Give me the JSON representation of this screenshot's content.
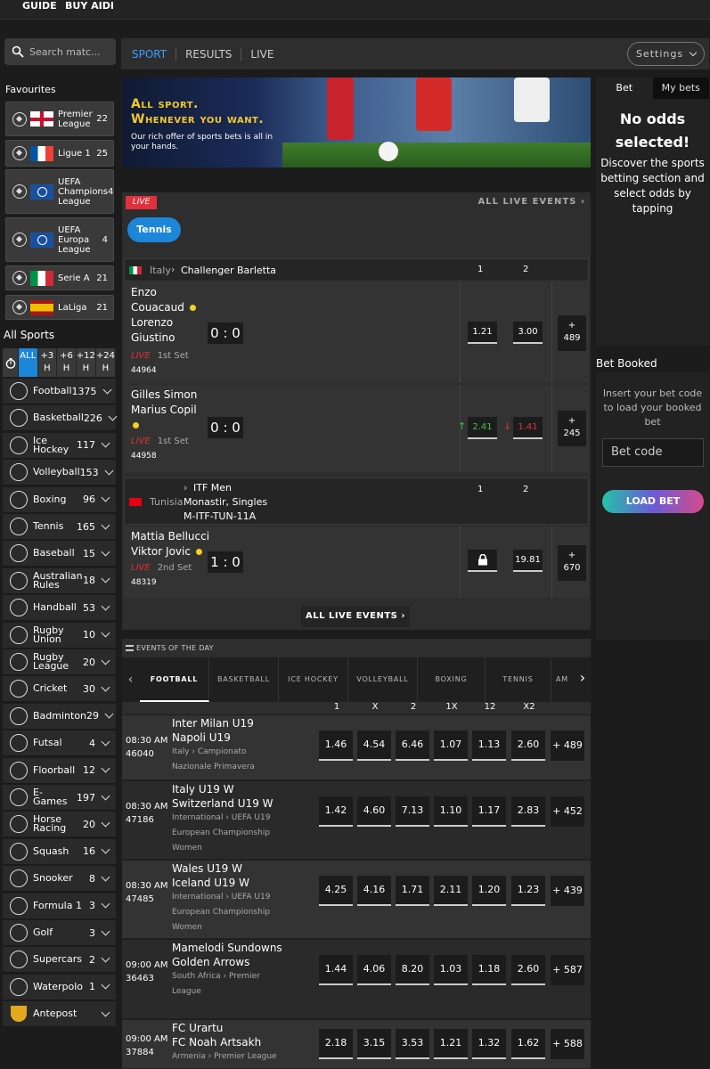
{
  "top_nav": {
    "guide": "GUIDE",
    "buy": "BUY AIDI"
  },
  "search": {
    "placeholder": "Search matc..."
  },
  "favourites": {
    "title": "Favourites",
    "items": [
      {
        "name": "Premier League",
        "count": "22",
        "flag": "england"
      },
      {
        "name": "Ligue 1",
        "count": "25",
        "flag": "france"
      },
      {
        "name": "UEFA Champions League",
        "count": "4",
        "flag": "europe"
      },
      {
        "name": "UEFA Europa League",
        "count": "4",
        "flag": "europe"
      },
      {
        "name": "Serie A",
        "count": "21",
        "flag": "italy"
      },
      {
        "name": "LaLiga",
        "count": "21",
        "flag": "spain"
      }
    ]
  },
  "all_sports": {
    "title": "All Sports",
    "time_filters": [
      "ALL",
      "+3 H",
      "+6 H",
      "+12 H",
      "+24 H"
    ],
    "items": [
      {
        "name": "Football",
        "count": "1375",
        "icon": "football-icon"
      },
      {
        "name": "Basketball",
        "count": "226",
        "icon": "basketball-icon"
      },
      {
        "name": "Ice Hockey",
        "count": "117",
        "icon": "ice-hockey-icon"
      },
      {
        "name": "Volleyball",
        "count": "153",
        "icon": "volleyball-icon"
      },
      {
        "name": "Boxing",
        "count": "96",
        "icon": "boxing-icon"
      },
      {
        "name": "Tennis",
        "count": "165",
        "icon": "tennis-icon"
      },
      {
        "name": "Baseball",
        "count": "15",
        "icon": "baseball-icon"
      },
      {
        "name": "Australian Rules",
        "count": "18",
        "icon": "australian-rules-icon"
      },
      {
        "name": "Handball",
        "count": "53",
        "icon": "handball-icon"
      },
      {
        "name": "Rugby Union",
        "count": "10",
        "icon": "rugby-union-icon"
      },
      {
        "name": "Rugby League",
        "count": "20",
        "icon": "rugby-league-icon"
      },
      {
        "name": "Cricket",
        "count": "30",
        "icon": "cricket-icon"
      },
      {
        "name": "Badminton",
        "count": "29",
        "icon": "badminton-icon"
      },
      {
        "name": "Futsal",
        "count": "4",
        "icon": "futsal-icon"
      },
      {
        "name": "Floorball",
        "count": "12",
        "icon": "floorball-icon"
      },
      {
        "name": "E-Games",
        "count": "197",
        "icon": "e-games-icon"
      },
      {
        "name": "Horse Racing",
        "count": "20",
        "icon": "horse-racing-icon"
      },
      {
        "name": "Squash",
        "count": "16",
        "icon": "squash-icon"
      },
      {
        "name": "Snooker",
        "count": "8",
        "icon": "snooker-icon"
      },
      {
        "name": "Formula 1",
        "count": "3",
        "icon": "formula1-icon"
      },
      {
        "name": "Golf",
        "count": "3",
        "icon": "golf-icon"
      },
      {
        "name": "Supercars",
        "count": "2",
        "icon": "supercars-icon"
      },
      {
        "name": "Waterpolo",
        "count": "1",
        "icon": "waterpolo-icon"
      },
      {
        "name": "Antepost",
        "count": "",
        "icon": "trophy-icon"
      }
    ]
  },
  "nav": {
    "sport": "SPORT",
    "results": "RESULTS",
    "live": "LIVE",
    "settings": "Settings"
  },
  "banner": {
    "headline_1": "All sport.",
    "headline_2": "Whenever you want.",
    "sub": "Our rich offer of sports bets is all in your hands."
  },
  "live": {
    "badge": "LIVE",
    "all_events": "ALL LIVE EVENTS",
    "sport_pill": "Tennis",
    "bottom_button": "ALL LIVE EVENTS",
    "leagues": [
      {
        "country": "Italy",
        "name": "Challenger Barletta",
        "col1": "1",
        "col2": "2",
        "events": [
          {
            "p1": "Enzo Couacaud",
            "p2": "Lorenzo Giustino",
            "score": "0 : 0",
            "live": "LIVE",
            "set": "1st Set",
            "id": "44964",
            "odd1": "1.21",
            "odd2": "3.00",
            "more_plus": "+",
            "more": "489"
          },
          {
            "p1": "Gilles Simon",
            "p2": "Marius Copil",
            "score": "0 : 0",
            "live": "LIVE",
            "set": "1st Set",
            "id": "44958",
            "odd1": "2.41",
            "odd2": "1.41",
            "more_plus": "+",
            "more": "245"
          }
        ]
      },
      {
        "country": "Tunisia",
        "name_1": "ITF Men",
        "name_2": "Monastir, Singles",
        "name_3": "M-ITF-TUN-11A",
        "col1": "1",
        "col2": "2",
        "events": [
          {
            "p1": "Mattia Bellucci",
            "p2": "Viktor Jovic",
            "score": "1 : 0",
            "live": "LIVE",
            "set": "2nd Set",
            "id": "48319",
            "odd1": "",
            "odd2": "19.81",
            "more_plus": "+",
            "more": "670"
          }
        ]
      }
    ]
  },
  "events_of_day": {
    "title": "EVENTS OF THE DAY",
    "tabs": [
      "FOOTBALL",
      "BASKETBALL",
      "ICE HOCKEY",
      "VOLLEYBALL",
      "BOXING",
      "TENNIS",
      "AM"
    ],
    "columns": [
      "1",
      "X",
      "2",
      "1X",
      "12",
      "X2"
    ],
    "rows": [
      {
        "time": "08:30 AM",
        "id": "46040",
        "team1": "Inter Milan U19",
        "team2": "Napoli U19",
        "country": "Italy",
        "league": "Campionato Nazionale Primavera",
        "odds": [
          "1.46",
          "4.54",
          "6.46",
          "1.07",
          "1.13",
          "2.60"
        ],
        "more": "+ 489"
      },
      {
        "time": "08:30 AM",
        "id": "47186",
        "team1": "Italy U19 W",
        "team2": "Switzerland U19 W",
        "country": "International",
        "league": "UEFA U19 European Championship Women",
        "odds": [
          "1.42",
          "4.60",
          "7.13",
          "1.10",
          "1.17",
          "2.83"
        ],
        "more": "+ 452"
      },
      {
        "time": "08:30 AM",
        "id": "47485",
        "team1": "Wales U19 W",
        "team2": "Iceland U19 W",
        "country": "International",
        "league": "UEFA U19 European Championship Women",
        "odds": [
          "4.25",
          "4.16",
          "1.71",
          "2.11",
          "1.20",
          "1.23"
        ],
        "more": "+ 439"
      },
      {
        "time": "09:00 AM",
        "id": "36463",
        "team1": "Mamelodi Sundowns",
        "team2": "Golden Arrows",
        "country": "South Africa",
        "league": "Premier League",
        "odds": [
          "1.44",
          "4.06",
          "8.20",
          "1.03",
          "1.18",
          "2.60"
        ],
        "more": "+ 587"
      },
      {
        "time": "09:00 AM",
        "id": "37884",
        "team1": "FC Urartu",
        "team2": "FC Noah Artsakh",
        "country": "Armenia",
        "league": "Premier League",
        "odds": [
          "2.18",
          "3.15",
          "3.53",
          "1.21",
          "1.32",
          "1.62"
        ],
        "more": "+ 588"
      }
    ]
  },
  "betslip": {
    "tab_bet": "Bet",
    "tab_mybets": "My bets",
    "empty_title": "No odds selected!",
    "empty_desc": "Discover the sports betting section and select odds by tapping"
  },
  "bet_booked": {
    "title": "Bet Booked",
    "desc": "Insert your bet code to load your booked bet",
    "placeholder": "Bet code",
    "button": "LOAD BET"
  },
  "colors": {
    "accent": "#1c86d9",
    "live": "#e0313d",
    "up": "#42c24a"
  }
}
